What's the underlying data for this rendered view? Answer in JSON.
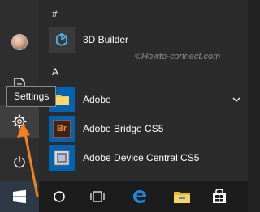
{
  "tooltip": {
    "label": "Settings"
  },
  "watermark": "©Howto-connect.com",
  "groups": [
    {
      "header": "#"
    },
    {
      "header": "A"
    }
  ],
  "apps": [
    {
      "name": "3D Builder",
      "icon": "3d-builder-icon",
      "tile_color": "#3a3a3a"
    },
    {
      "name": "Adobe",
      "icon": "folder-icon",
      "tile_color": "#0063b1"
    },
    {
      "name": "Adobe Bridge CS5",
      "icon": "adobe-bridge-icon",
      "tile_color": "#0063b1"
    },
    {
      "name": "Adobe Device Central CS5",
      "icon": "adobe-device-central-icon",
      "tile_color": "#0063b1"
    }
  ],
  "bridge_badge": "Br",
  "rail": [
    {
      "icon": "user-avatar"
    },
    {
      "icon": "documents-icon"
    },
    {
      "icon": "gear-icon",
      "label": "Settings",
      "hovered": true
    },
    {
      "icon": "power-icon"
    }
  ],
  "taskbar": [
    {
      "icon": "windows-start-icon"
    },
    {
      "icon": "cortana-search-icon"
    },
    {
      "icon": "task-view-icon"
    },
    {
      "icon": "edge-icon"
    },
    {
      "icon": "file-explorer-icon"
    },
    {
      "icon": "store-icon"
    }
  ],
  "colors": {
    "accent": "#0063b1",
    "arrow": "#f58220",
    "edge": "#1e88e5"
  }
}
